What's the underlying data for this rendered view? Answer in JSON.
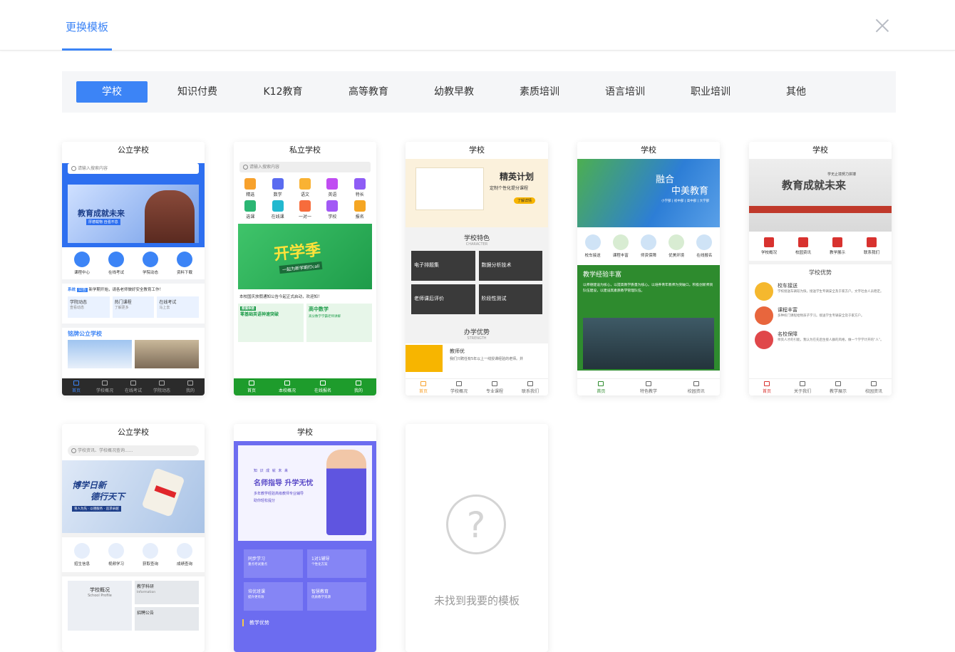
{
  "header": {
    "tab_label": "更换模板"
  },
  "categories": [
    "学校",
    "知识付费",
    "K12教育",
    "高等教育",
    "幼教早教",
    "素质培训",
    "语言培训",
    "职业培训",
    "其他"
  ],
  "colors": {
    "accent": "#3c84f6"
  },
  "cards": {
    "c1": {
      "title": "公立学校",
      "search": "请输入搜索内容",
      "banner_title": "教育成就未来",
      "banner_sub": "厚德载物 自强不息",
      "icons": [
        "课程中心",
        "在线考试",
        "学院动态",
        "资料下载"
      ],
      "notice_label": "系统",
      "notice_tag": "公告",
      "notice_text": "新学期开始，请各老师做好安全教育工作！",
      "tiles": [
        {
          "t": "学院动态",
          "s": "查看动态"
        },
        {
          "t": "热门课程",
          "s": "了解更多"
        },
        {
          "t": "在线考试",
          "s": "马上去"
        }
      ],
      "school_name": "铭牌公立学校",
      "nav": [
        "首页",
        "学校概况",
        "在线考试",
        "学院动态",
        "我的"
      ]
    },
    "c2": {
      "title": "私立学校",
      "search": "请输入搜索内容",
      "icons": [
        "精选",
        "数学",
        "语文",
        "英语",
        "特长",
        "选课",
        "在线课",
        "一对一",
        "学校",
        "报名"
      ],
      "banner_title": "开学季",
      "banner_sub": "一起为新学期打call",
      "notice": "本校国庆放假通知公告今起正式启动，欢迎知！",
      "promo1_tag": "超值体验",
      "promo1": "零基础英语神速突破",
      "promo2": "高中数学",
      "promo2_sub": "高分数学学霸老师讲解",
      "nav": [
        "首页",
        "本校概况",
        "在线报名",
        "我的"
      ]
    },
    "c3": {
      "title": "学校",
      "banner_title": "精英计划",
      "banner_sub": "定制个性化提分课程",
      "banner_btn": "了解详情",
      "section1": "学校特色",
      "section1_en": "CHARACTER",
      "features": [
        "电子排题集",
        "数据分析技术",
        "老师课后评价",
        "阶段性测试"
      ],
      "section2": "办学优势",
      "section2_en": "STRENGTH",
      "adv_title": "教师优",
      "adv_text": "我们只聘任有5年以上一线授课经验的老师。并",
      "nav": [
        "首页",
        "学校概况",
        "专业课程",
        "联系我们"
      ]
    },
    "c4": {
      "title": "学校",
      "banner_title1": "融合",
      "banner_title2": "中美教育",
      "banner_sub": "小学部 | 初中部 | 高中部 | 大学部",
      "icons": [
        "校车接送",
        "课程丰富",
        "师资保障",
        "优美环境",
        "在线报名"
      ],
      "section": "教学经验丰富",
      "text": "以师德建设为核心，以提高教学质量为核心。以培养青年教师为突破口。积极创新师资队伍建设，以建设高素质教学管理队伍。",
      "nav": [
        "首页",
        "特色教学",
        "校园资讯"
      ]
    },
    "c5": {
      "title": "学校",
      "banner_title": "教育成就未来",
      "banner_sub": "学无止境努力拼搏",
      "icons": [
        "学校概况",
        "校园资讯",
        "教学展示",
        "联系我们"
      ],
      "section": "学校优势",
      "items": [
        {
          "t": "校车接送",
          "d": "学校接送车辆较为快，接送学生专辆安全及于家方户。文字社会人员稳定。"
        },
        {
          "t": "课程丰富",
          "d": "多种校门课程给物孩子学习。接送学生专辆安全及于家方户。"
        },
        {
          "t": "名校保障",
          "d": "师资人才的引能，我认为在先后生接人群的风格，做一个学学计开的“人”。"
        }
      ],
      "nav": [
        "首页",
        "关于我们",
        "教学展示",
        "校园资讯"
      ]
    },
    "c6": {
      "title": "公立学校",
      "search": "学校资讯、学校概况查询......",
      "banner_title1": "博学日新",
      "banner_title2": "德行天下",
      "banner_sub": "育人为先 · 以德服务 · 追求卓越",
      "icons": [
        "招生信息",
        "视频学习",
        "获取查询",
        "成绩查询"
      ],
      "tile1": "学校概况",
      "tile1_en": "School Profile",
      "tile2": "教学科研",
      "tile2_en": "Information",
      "tile3": "招聘公告"
    },
    "c7": {
      "title": "学校",
      "banner_small": "知 识 成 就 未 来",
      "banner_title": "名师指导 升学无忧",
      "banner_text1": "多年教学经验高级教师专业辅导",
      "banner_text2": "助你轻松提分",
      "tiles": [
        {
          "t": "同步学习",
          "s": "重点考试重点"
        },
        {
          "t": "1对1辅导",
          "s": "个性化方案"
        },
        {
          "t": "培优班课",
          "s": "提升更有效"
        },
        {
          "t": "智慧教育",
          "s": "优质教学资源"
        }
      ],
      "section": "教学优势"
    }
  },
  "empty_card": {
    "label": "未找到我要的模板"
  }
}
